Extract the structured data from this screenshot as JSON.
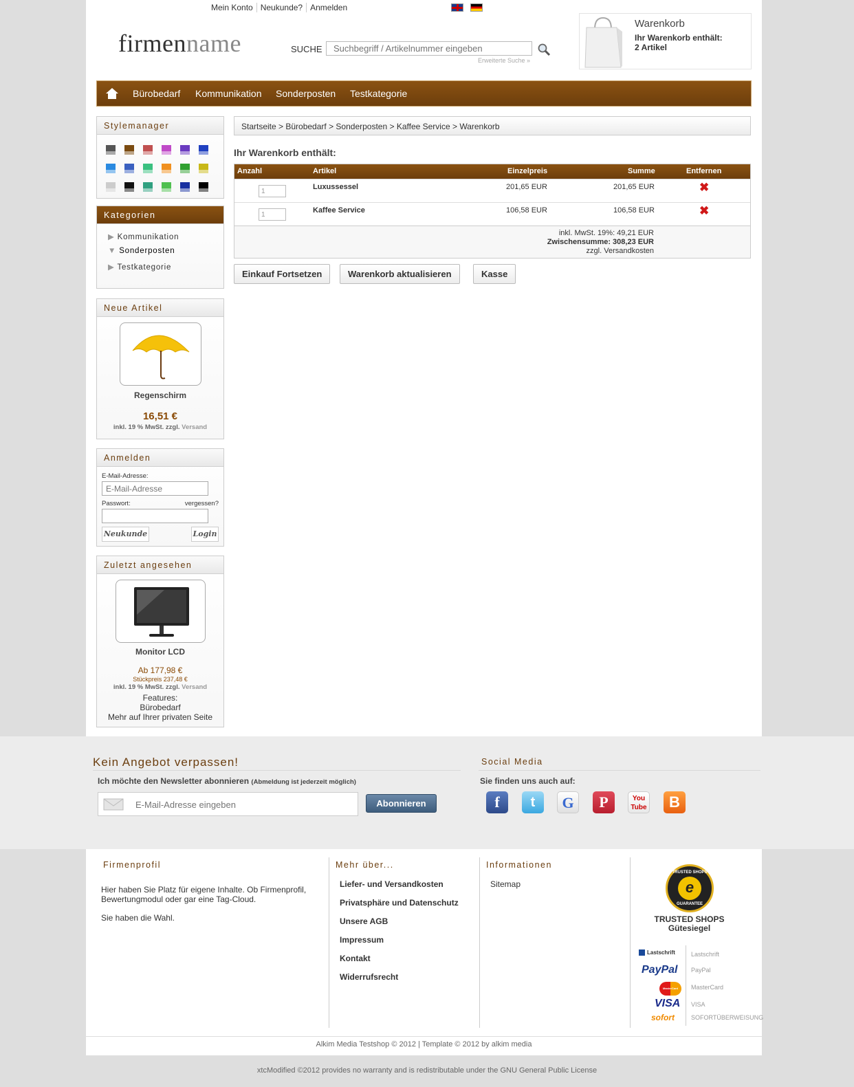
{
  "header": {
    "links": [
      "Mein Konto",
      "Neukunde?",
      "Anmelden"
    ],
    "logo_part1": "firmen",
    "logo_part2": "name",
    "search_label": "SUCHE",
    "search_placeholder": "Suchbegriff / Artikelnummer eingeben",
    "advanced": "Erweiterte Suche »"
  },
  "cart_box": {
    "title": "Warenkorb",
    "line1": "Ihr Warenkorb enthält:",
    "line2": "2 Artikel"
  },
  "nav": {
    "items": [
      "Bürobedarf",
      "Kommunikation",
      "Sonderposten",
      "Testkategorie"
    ]
  },
  "stylemanager": {
    "title": "Stylemanager",
    "swatches": [
      "#555555",
      "#7a4a10",
      "#c05050",
      "#c04ac8",
      "#6a3ac0",
      "#2040c0",
      "#2a8ae0",
      "#3a60c0",
      "#3ac080",
      "#f09020",
      "#30a030",
      "#c8b818",
      "#cccccc",
      "#111111",
      "#30a080",
      "#50c050",
      "#1830a0",
      "#000000"
    ]
  },
  "categories": {
    "title": "Kategorien",
    "items": [
      "Kommunikation",
      "Sonderposten",
      "Testkategorie"
    ]
  },
  "new_items": {
    "title": "Neue Artikel",
    "name": "Regenschirm",
    "price": "16,51 €",
    "tax": "inkl. 19 % MwSt. zzgl.",
    "shipping": "Versand"
  },
  "login": {
    "title": "Anmelden",
    "email_label": "E-Mail-Adresse:",
    "email_placeholder": "E-Mail-Adresse",
    "password_label": "Passwort:",
    "forgot": "vergessen?",
    "new_customer": "Neukunde",
    "login": "Login"
  },
  "recent": {
    "title": "Zuletzt angesehen",
    "name": "Monitor LCD",
    "price": "Ab 177,98 €",
    "unit": "Stückpreis 237,48 €",
    "tax": "inkl. 19 % MwSt. zzgl.",
    "shipping": "Versand",
    "features_label": "Features:",
    "features": "Bürobedarf",
    "more": "Mehr auf Ihrer privaten Seite"
  },
  "breadcrumb": "Startseite > Bürobedarf > Sonderposten > Kaffee Service > Warenkorb",
  "cart": {
    "heading": "Ihr Warenkorb enthält:",
    "columns": {
      "qty": "Anzahl",
      "item": "Artikel",
      "unit": "Einzelpreis",
      "sum": "Summe",
      "remove": "Entfernen"
    },
    "rows": [
      {
        "qty": "1",
        "name": "Luxussessel",
        "unit": "201,65 EUR",
        "sum": "201,65 EUR"
      },
      {
        "qty": "1",
        "name": "Kaffee Service",
        "unit": "106,58 EUR",
        "sum": "106,58 EUR"
      }
    ],
    "tax": "inkl. MwSt. 19%: 49,21 EUR",
    "subtotal": "Zwischensumme: 308,23 EUR",
    "shipping": "zzgl. Versandkosten"
  },
  "buttons": {
    "continue": "Einkauf Fortsetzen",
    "update": "Warenkorb aktualisieren",
    "checkout": "Kasse"
  },
  "newsletter": {
    "title": "Kein Angebot verpassen!",
    "text": "Ich möchte den Newsletter abonnieren",
    "note": "(Abmeldung ist jederzeit möglich)",
    "placeholder": "E-Mail-Adresse eingeben",
    "button": "Abonnieren"
  },
  "social": {
    "title": "Social Media",
    "text": "Sie finden uns auch auf:"
  },
  "footer": {
    "col1_title": "Firmenprofil",
    "col1_text1": "Hier haben Sie Platz für eigene Inhalte. Ob Firmenprofil, Bewertungmodul oder gar eine Tag-Cloud.",
    "col1_text2": "Sie haben die Wahl.",
    "col2_title": "Mehr über...",
    "col2_links": [
      "Liefer- und Versandkosten",
      "Privatsphäre und Datenschutz",
      "Unsere AGB",
      "Impressum",
      "Kontakt",
      "Widerrufsrecht"
    ],
    "col3_title": "Informationen",
    "col3_links": [
      "Sitemap"
    ],
    "ts1": "TRUSTED SHOPS",
    "ts2": "Gütesiegel",
    "seal_top": "TRUSTED SHOPS",
    "seal_bottom": "GUARANTEE",
    "payments": [
      {
        "logo": "Lastschrift",
        "name": "Lastschrift"
      },
      {
        "logo": "PayPal",
        "name": "PayPal"
      },
      {
        "logo": "MasterCard",
        "name": "MasterCard"
      },
      {
        "logo": "VISA",
        "name": "VISA"
      },
      {
        "logo": "sofort",
        "name": "SOFORTÜBERWEISUNG"
      }
    ],
    "copyright": "Alkim Media Testshop © 2012 | Template © 2012 by alkim media"
  },
  "bottom_note": "xtcModified ©2012 provides no warranty and is redistributable under the GNU General Public License"
}
